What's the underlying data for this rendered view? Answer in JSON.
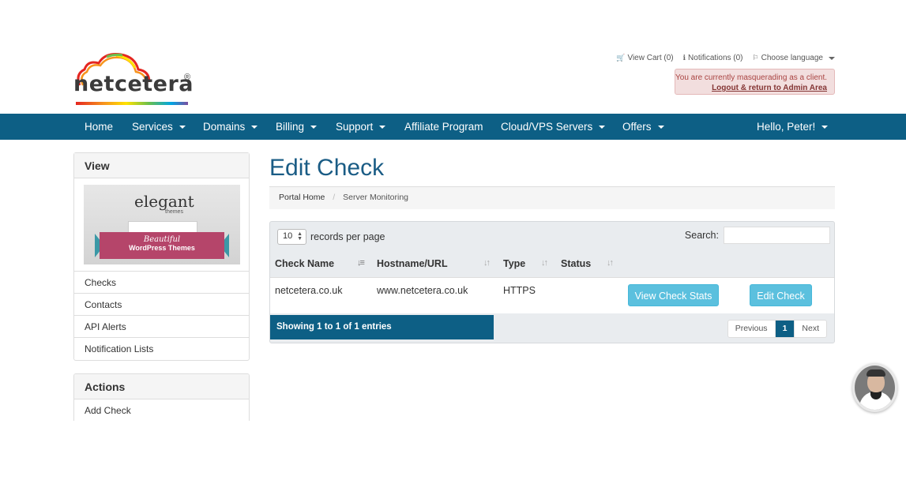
{
  "brand": {
    "logo_text": "netcetera",
    "reg_mark": "®",
    "arc_colors": [
      "#e52620",
      "#f7941d",
      "#ffe200",
      "#6abf4b",
      "#00a5e3",
      "#7b4fa0"
    ]
  },
  "top_links": {
    "cart": "View Cart (0)",
    "notifications": "Notifications (0)",
    "language": "Choose language"
  },
  "masquerade": {
    "message": "You are currently masquerading as a client.",
    "link": "Logout & return to Admin Area"
  },
  "nav": {
    "home": "Home",
    "services": "Services",
    "domains": "Domains",
    "billing": "Billing",
    "support": "Support",
    "affiliate": "Affiliate Program",
    "cloud": "Cloud/VPS Servers",
    "offers": "Offers",
    "user": "Hello, Peter!"
  },
  "sidebar": {
    "view_title": "View",
    "banner": {
      "brand": "elegant",
      "sub": "themes",
      "line1": "Beautiful",
      "line2": "WordPress Themes"
    },
    "view_items": [
      "Checks",
      "Contacts",
      "API Alerts",
      "Notification Lists"
    ],
    "actions_title": "Actions",
    "action_items": [
      "Add Check"
    ]
  },
  "main": {
    "title": "Edit Check",
    "breadcrumb": [
      "Portal Home",
      "Server Monitoring"
    ],
    "table": {
      "length_value": "10",
      "length_label": "records per page",
      "search_label": "Search:",
      "search_value": "",
      "columns": [
        "Check Name",
        "Hostname/URL",
        "Type",
        "Status"
      ],
      "rows": [
        {
          "name": "netcetera.co.uk",
          "host": "www.netcetera.co.uk",
          "type": "HTTPS",
          "status": "",
          "stats_btn": "View Check Stats",
          "edit_btn": "Edit Check"
        }
      ],
      "info": "Showing 1 to 1 of 1 entries",
      "pager": {
        "prev": "Previous",
        "page": "1",
        "next": "Next"
      }
    }
  },
  "colors": {
    "nav_bg": "#0d5f85",
    "button": "#5bc0de",
    "title": "#1a5c85",
    "alert_bg": "#f2dede"
  }
}
